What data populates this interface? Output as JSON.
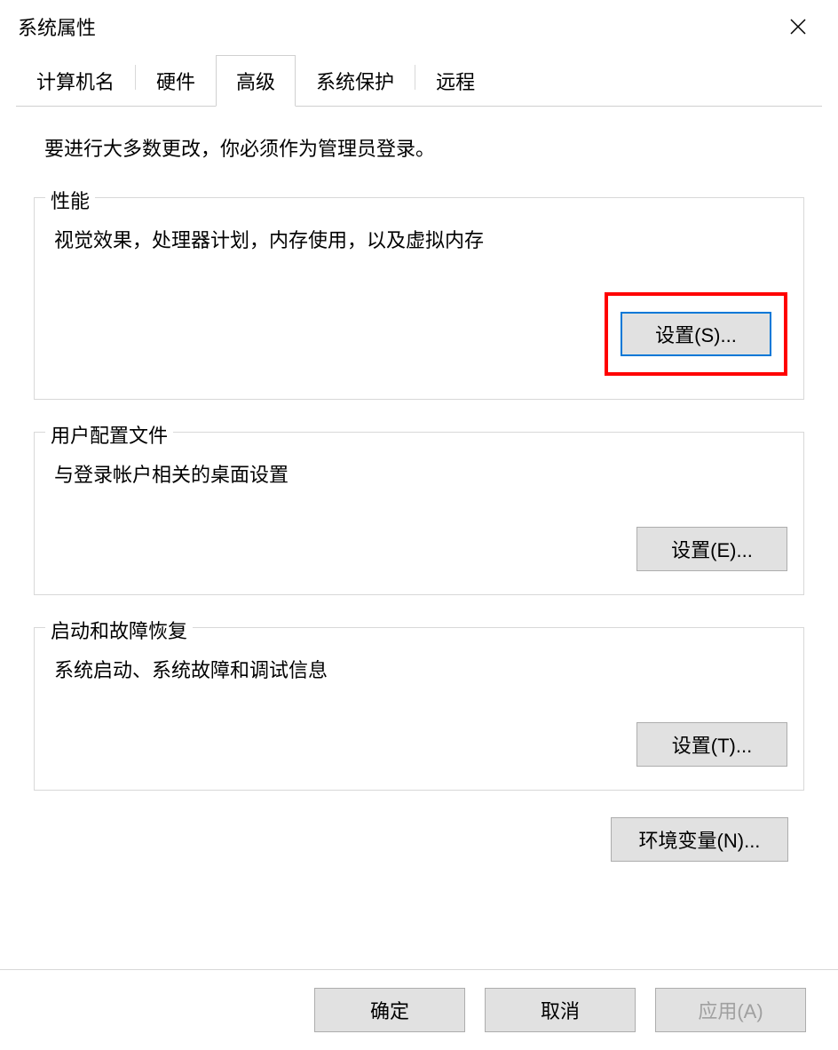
{
  "window": {
    "title": "系统属性"
  },
  "tabs": {
    "items": [
      {
        "label": "计算机名"
      },
      {
        "label": "硬件"
      },
      {
        "label": "高级",
        "active": true
      },
      {
        "label": "系统保护"
      },
      {
        "label": "远程"
      }
    ]
  },
  "content": {
    "admin_note": "要进行大多数更改，你必须作为管理员登录。",
    "performance": {
      "legend": "性能",
      "desc": "视觉效果，处理器计划，内存使用，以及虚拟内存",
      "button": "设置(S)..."
    },
    "user_profiles": {
      "legend": "用户配置文件",
      "desc": "与登录帐户相关的桌面设置",
      "button": "设置(E)..."
    },
    "startup_recovery": {
      "legend": "启动和故障恢复",
      "desc": "系统启动、系统故障和调试信息",
      "button": "设置(T)..."
    },
    "env_vars_button": "环境变量(N)..."
  },
  "footer": {
    "ok": "确定",
    "cancel": "取消",
    "apply": "应用(A)"
  }
}
